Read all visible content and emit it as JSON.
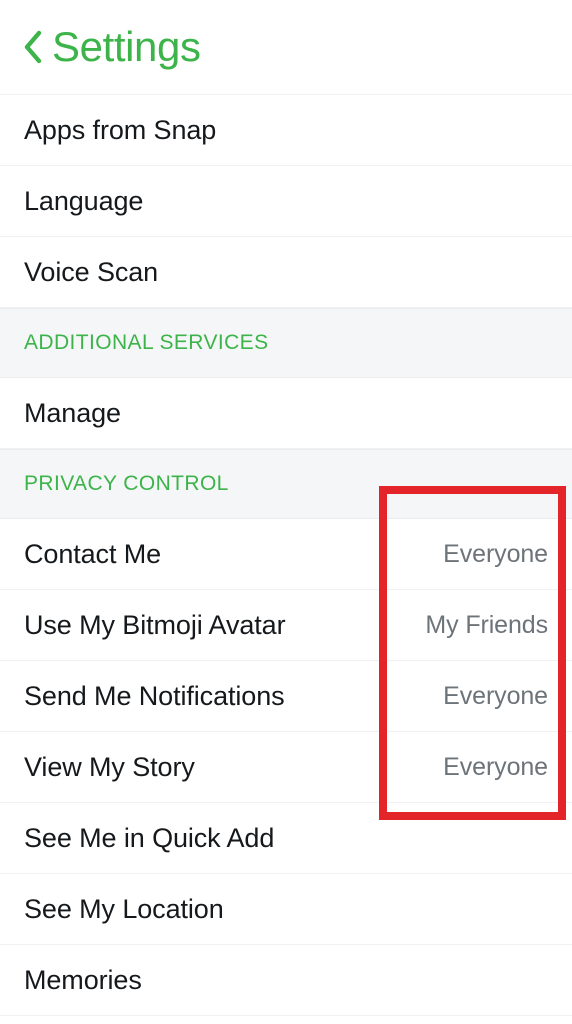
{
  "header": {
    "back_icon": "chevron-left-icon",
    "title": "Settings"
  },
  "list": {
    "top_items": [
      {
        "label": "Apps from Snap",
        "value": ""
      },
      {
        "label": "Language",
        "value": ""
      },
      {
        "label": "Voice Scan",
        "value": ""
      }
    ],
    "section_additional_services": "ADDITIONAL SERVICES",
    "additional_services_items": [
      {
        "label": "Manage",
        "value": ""
      }
    ],
    "section_privacy_control": "PRIVACY CONTROL",
    "privacy_items": [
      {
        "label": "Contact Me",
        "value": "Everyone"
      },
      {
        "label": "Use My Bitmoji Avatar",
        "value": "My Friends"
      },
      {
        "label": "Send Me Notifications",
        "value": "Everyone"
      },
      {
        "label": "View My Story",
        "value": "Everyone"
      },
      {
        "label": "See Me in Quick Add",
        "value": ""
      },
      {
        "label": "See My Location",
        "value": ""
      },
      {
        "label": "Memories",
        "value": ""
      }
    ]
  },
  "annotation": {
    "name": "red-highlight-rectangle",
    "color": "#e32429"
  },
  "colors": {
    "accent_green": "#3cb44a",
    "label_text": "#16191c",
    "value_text": "#6d7479",
    "section_band_bg": "#f5f6f8",
    "divider": "#f0f1f2",
    "annotation_red": "#e32429"
  }
}
